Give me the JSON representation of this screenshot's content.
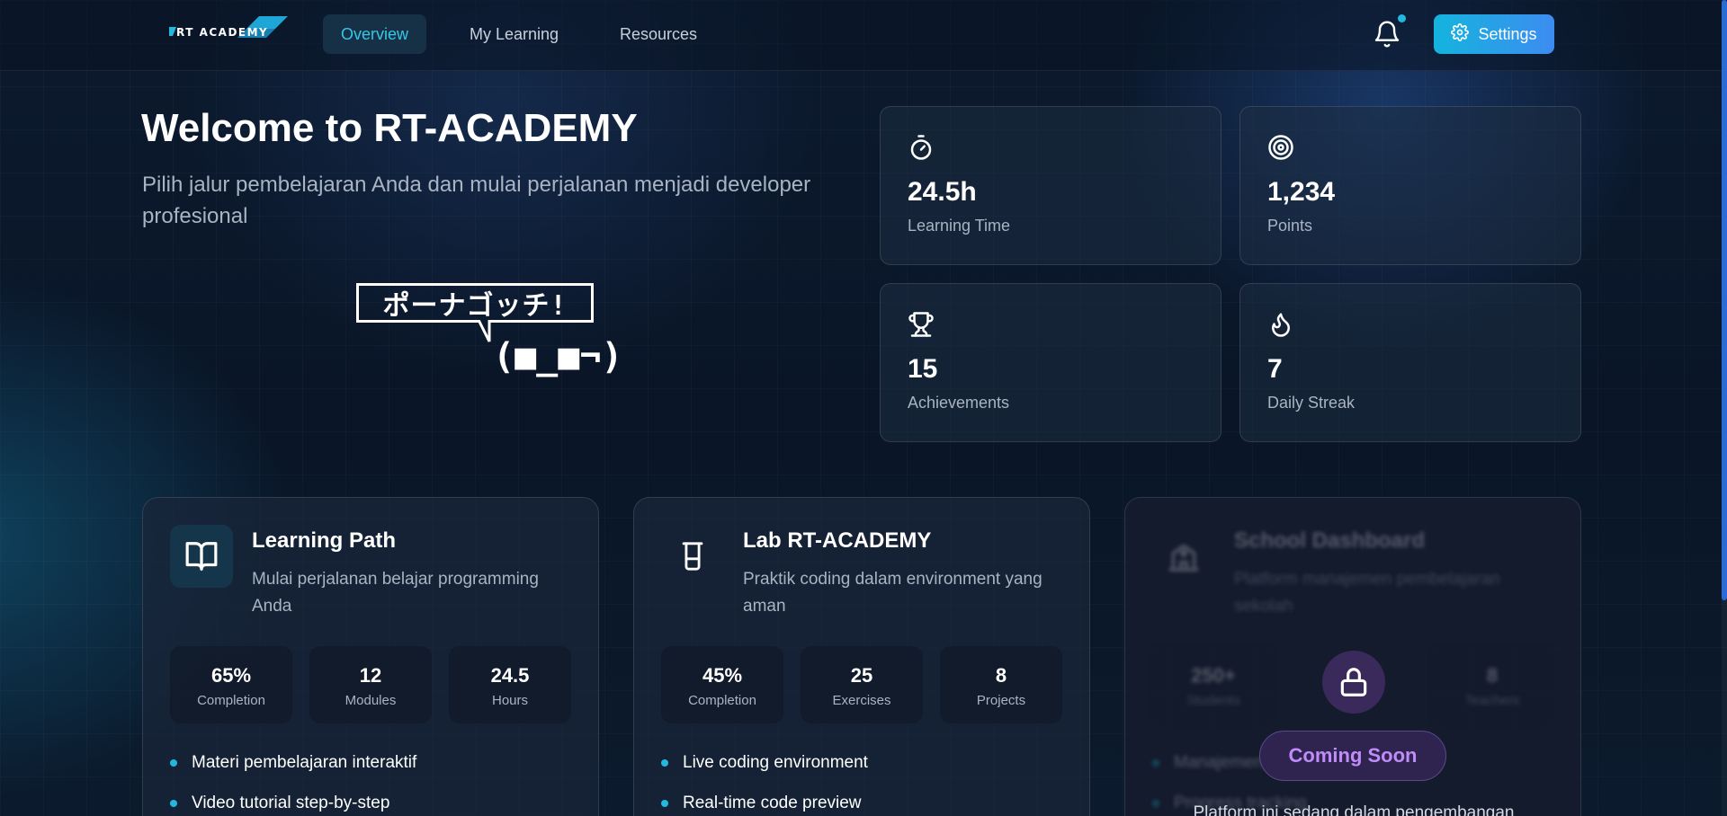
{
  "brand": {
    "logo_text": "RT ACADEMY"
  },
  "nav": {
    "tabs": [
      {
        "label": "Overview",
        "active": true
      },
      {
        "label": "My Learning",
        "active": false
      },
      {
        "label": "Resources",
        "active": false
      }
    ],
    "settings_label": "Settings",
    "has_notification": true
  },
  "hero": {
    "title": "Welcome to RT-ACADEMY",
    "subtitle": "Pilih jalur pembelajaran Anda dan mulai perjalanan menjadi developer profesional",
    "ascii_bubble": "ポーナゴッチ!",
    "ascii_face": "(■_■¬)"
  },
  "stats": [
    {
      "icon": "stopwatch-icon",
      "value": "24.5h",
      "label": "Learning Time"
    },
    {
      "icon": "target-icon",
      "value": "1,234",
      "label": "Points"
    },
    {
      "icon": "trophy-icon",
      "value": "15",
      "label": "Achievements"
    },
    {
      "icon": "flame-icon",
      "value": "7",
      "label": "Daily Streak"
    }
  ],
  "cards": [
    {
      "icon": "book-open-icon",
      "title": "Learning Path",
      "description": "Mulai perjalanan belajar programming Anda",
      "stats": [
        {
          "value": "65%",
          "label": "Completion"
        },
        {
          "value": "12",
          "label": "Modules"
        },
        {
          "value": "24.5",
          "label": "Hours"
        }
      ],
      "features": [
        "Materi pembelajaran interaktif",
        "Video tutorial step-by-step"
      ]
    },
    {
      "icon": "beaker-icon",
      "title": "Lab RT-ACADEMY",
      "description": "Praktik coding dalam environment yang aman",
      "stats": [
        {
          "value": "45%",
          "label": "Completion"
        },
        {
          "value": "25",
          "label": "Exercises"
        },
        {
          "value": "8",
          "label": "Projects"
        }
      ],
      "features": [
        "Live coding environment",
        "Real-time code preview"
      ]
    },
    {
      "icon": "school-icon",
      "title": "School Dashboard",
      "description": "Platform manajemen pembelajaran sekolah",
      "stats": [
        {
          "value": "250+",
          "label": "Students"
        },
        {
          "value": "8",
          "label": "Teachers"
        }
      ],
      "features": [
        "Manajemen kelas",
        "Progress tracking"
      ],
      "locked": true,
      "badge": "Coming Soon",
      "locked_message": "Platform ini sedang dalam pengembangan"
    }
  ],
  "colors": {
    "accent": "#22b8e0",
    "locked_badge": "#c08cf8"
  }
}
